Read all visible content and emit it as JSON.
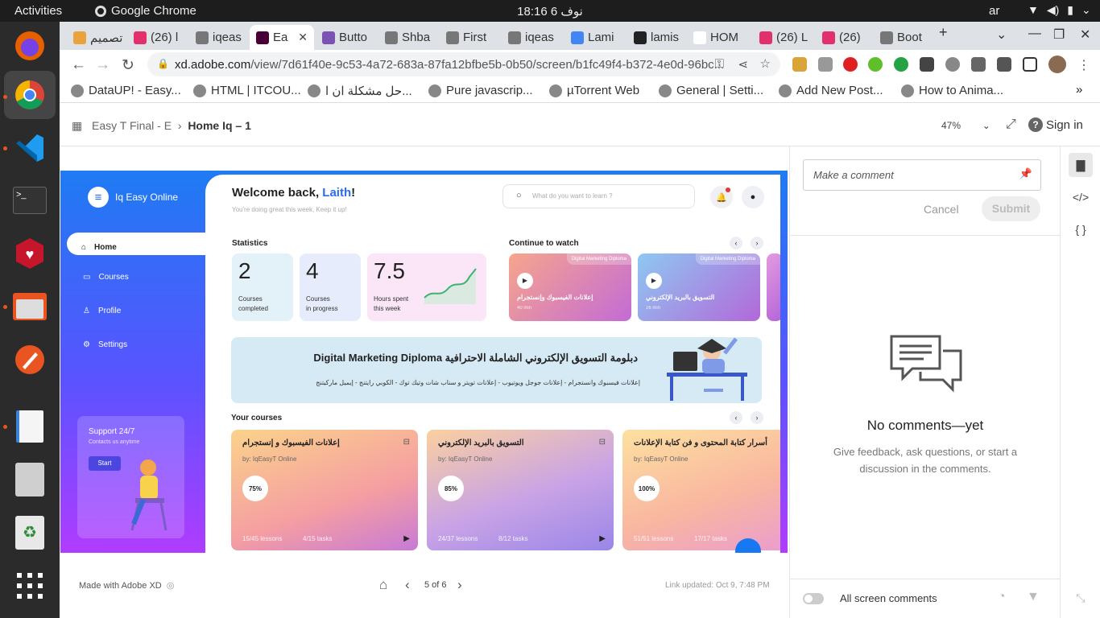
{
  "system": {
    "activities": "Activities",
    "app_name": "Google Chrome",
    "clock": "18:16  6 نوف",
    "lang": "ar"
  },
  "tabs": [
    {
      "label": "تصميم",
      "color": "#e8a33d"
    },
    {
      "label": "(26) l",
      "color": "#e1306c"
    },
    {
      "label": "iqeas",
      "color": "#777777"
    },
    {
      "label": "Ea",
      "color": "#470137"
    },
    {
      "label": "Butto",
      "color": "#7952b3"
    },
    {
      "label": "Shba",
      "color": "#777777"
    },
    {
      "label": "First",
      "color": "#777777"
    },
    {
      "label": "iqeas",
      "color": "#777777"
    },
    {
      "label": "Lami",
      "color": "#4285f4"
    },
    {
      "label": "lamis",
      "color": "#222222"
    },
    {
      "label": "HOM",
      "color": "#ffffff"
    },
    {
      "label": "(26) L",
      "color": "#e1306c"
    },
    {
      "label": "(26)",
      "color": "#e1306c"
    },
    {
      "label": "Boot",
      "color": "#777777"
    }
  ],
  "omnibox": {
    "domain": "xd.adobe.com",
    "path": "/view/7d61f40e-9c53-4a72-683a-87fa12bfbe5b-0b50/screen/b1fc49f4-b372-4e0d-96bc..."
  },
  "bookmarks": [
    {
      "label": "DataUP! - Easy..."
    },
    {
      "label": "HTML | ITCOU..."
    },
    {
      "label": "حل مشكلة ان ا..."
    },
    {
      "label": "Pure javascrip..."
    },
    {
      "label": "µTorrent Web"
    },
    {
      "label": "General | Setti..."
    },
    {
      "label": "Add New Post..."
    },
    {
      "label": "How to Anima..."
    }
  ],
  "xd": {
    "project": "Easy T Final - E",
    "screen": "Home Iq – 1",
    "zoom": "47%",
    "signin": "Sign in",
    "made_with": "Made with Adobe XD",
    "page": "5 of 6",
    "updated": "Link updated: Oct 9, 7:48 PM"
  },
  "design": {
    "brand": "Iq Easy Online",
    "menu": [
      "Home",
      "Courses",
      "Profile",
      "Settings"
    ],
    "support_title": "Support 24/7",
    "support_sub": "Contacts us anytime",
    "support_btn": "Start",
    "welcome": "Welcome back,",
    "user": "Laith",
    "welcome_sub": "You're doing great this week, Keep it up!",
    "search_placeholder": "What do you want to learn ?",
    "statistics_title": "Statistics",
    "continue_title": "Continue to watch",
    "your_courses_title": "Your courses",
    "stats": [
      {
        "value": "2",
        "label1": "Courses",
        "label2": "completed",
        "color": "#e3f1f8"
      },
      {
        "value": "4",
        "label1": "Courses",
        "label2": "in progress",
        "color": "#e6ecfb"
      },
      {
        "value": "7.5",
        "label1": "Hours spent",
        "label2": "this week",
        "color": "#fbe6f7"
      }
    ],
    "continue": [
      {
        "tag": "Digital Marketing Diploma",
        "title": "إعلانات الفيسبوك وإنستجرام",
        "meta": "40 min",
        "color": "linear-gradient(135deg,#f7a58c,#c36bd6)"
      },
      {
        "tag": "Digital Marketing Diploma",
        "title": "التسويق بالبريد الإلكتروني",
        "meta": "26 min",
        "color": "linear-gradient(135deg,#8ec8f2,#b368d9)"
      }
    ],
    "banner_title": "دبلومة التسويق الإلكتروني الشاملة الاحترافية Digital Marketing Diploma",
    "banner_sub": "إعلانات فيسبوك وانستجرام  - إعلانات جوجل ويوتيوب - إعلانات تويتر و سناب شات وتيك توك - الكوبي رايتنج - إيميل ماركيتنج",
    "courses": [
      {
        "title": "إعلانات الفيسبوك و إنستجرام",
        "by": "by: IqEasyT Online",
        "pct": "75%",
        "lessons": "15/45 lessons",
        "tasks": "4/15 tasks",
        "color": "linear-gradient(160deg,#fbd38a,#f59ea2 60%,#c77ad6)"
      },
      {
        "title": "التسويق بالبريد الإلكتروني",
        "by": "by: IqEasyT Online",
        "pct": "85%",
        "lessons": "24/37 lessons",
        "tasks": "8/12 tasks",
        "color": "linear-gradient(160deg,#fbd0a0,#c9a3e6 55%,#9a86e8)"
      },
      {
        "title": "أسرار كتابة المحتوى و فن كتابة الإعلانات",
        "by": "by: IqEasyT Online",
        "pct": "100%",
        "lessons": "51/51 lessons",
        "tasks": "17/17 tasks",
        "color": "linear-gradient(160deg,#fde1a0,#f9b6a0 55%,#e99ad2)"
      }
    ]
  },
  "comments": {
    "placeholder": "Make a comment",
    "cancel": "Cancel",
    "submit": "Submit",
    "empty_title": "No comments—yet",
    "empty_sub": "Give feedback, ask questions, or start a discussion in the comments.",
    "all_screens": "All screen comments"
  }
}
